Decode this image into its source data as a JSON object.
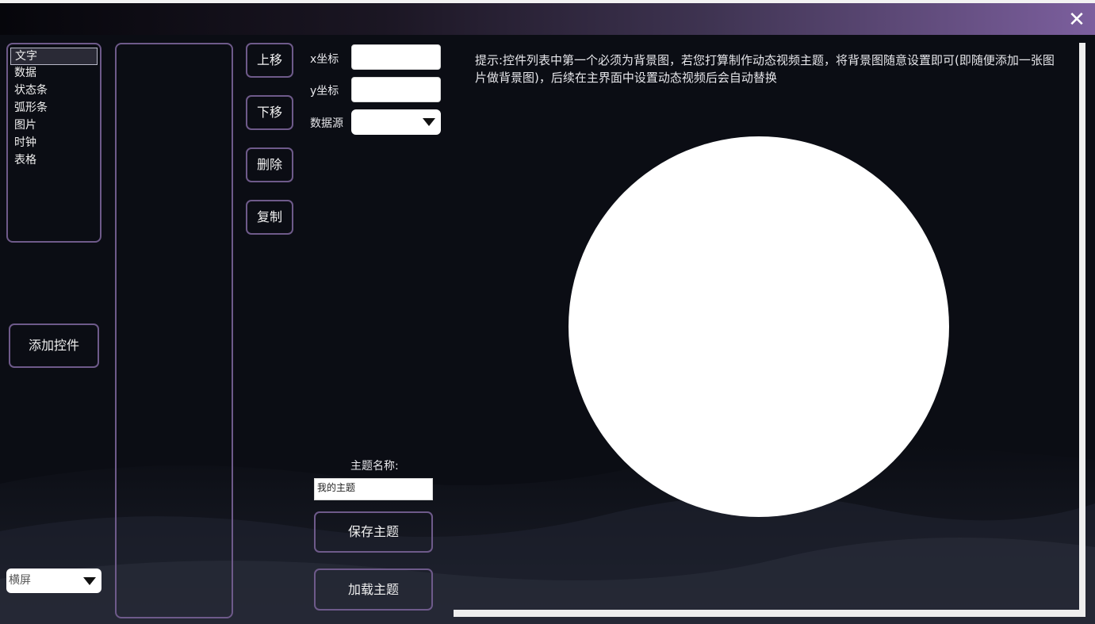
{
  "window": {
    "close_glyph": "✕"
  },
  "widget_types": [
    "文字",
    "数据",
    "状态条",
    "弧形条",
    "图片",
    "时钟",
    "表格"
  ],
  "buttons": {
    "add_widget": "添加控件",
    "move_up": "上移",
    "move_down": "下移",
    "delete": "删除",
    "copy": "复制",
    "save_theme": "保存主题",
    "load_theme": "加载主题"
  },
  "properties": {
    "x_label": "x坐标",
    "x_value": "",
    "y_label": "y坐标",
    "y_value": "",
    "datasource_label": "数据源",
    "datasource_value": ""
  },
  "theme": {
    "name_label": "主题名称:",
    "name_value": "我的主题"
  },
  "orientation": {
    "selected": "横屏"
  },
  "hint_text": "提示:控件列表中第一个必须为背景图，若您打算制作动态视频主题，将背景图随意设置即可(即随便添加一张图片做背景图)，后续在主界面中设置动态视频后会自动替换",
  "colors": {
    "accent_border": "#6e5a8a",
    "background": "#0b0d14",
    "titlebar_end": "#7c5f9e"
  }
}
